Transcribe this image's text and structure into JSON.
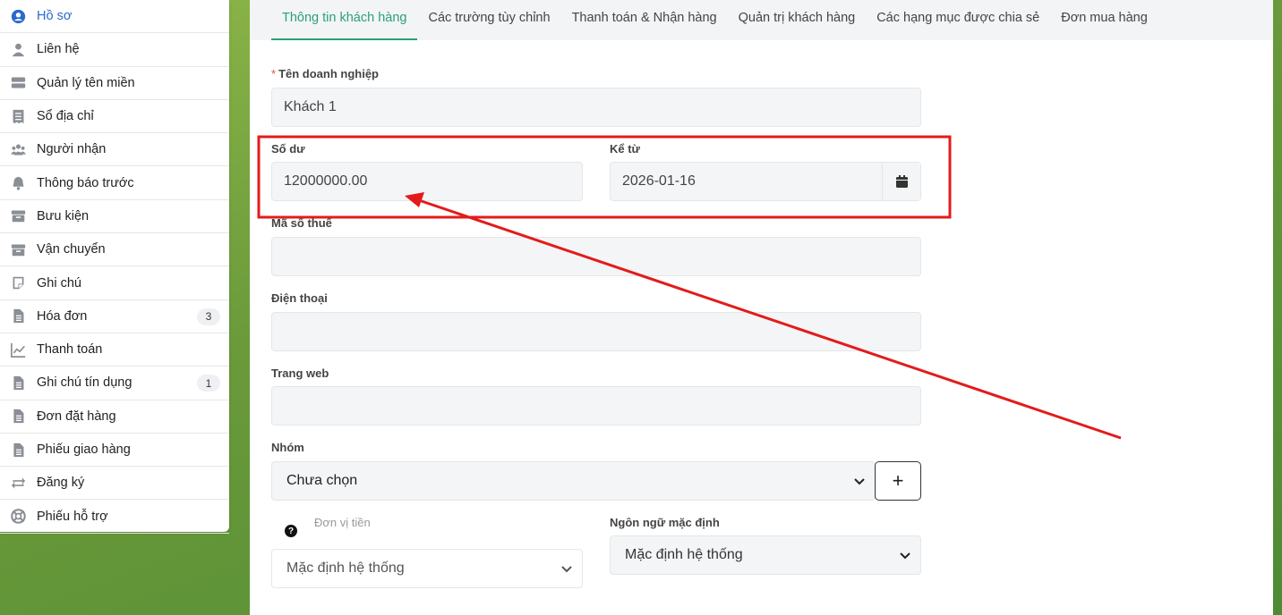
{
  "sidebar": {
    "items": [
      {
        "label": "Hồ sơ",
        "icon": "user-circle-icon"
      },
      {
        "label": "Liên hệ",
        "icon": "person-icon"
      },
      {
        "label": "Quản lý tên miền",
        "icon": "server-icon"
      },
      {
        "label": "Sổ địa chỉ",
        "icon": "receipt-icon"
      },
      {
        "label": "Người nhận",
        "icon": "users-icon"
      },
      {
        "label": "Thông báo trước",
        "icon": "bell-icon"
      },
      {
        "label": "Bưu kiện",
        "icon": "box-icon"
      },
      {
        "label": "Vận chuyển",
        "icon": "box-icon"
      },
      {
        "label": "Ghi chú",
        "icon": "note-icon"
      },
      {
        "label": "Hóa đơn",
        "icon": "document-icon",
        "badge": "3"
      },
      {
        "label": "Thanh toán",
        "icon": "chart-line-icon"
      },
      {
        "label": "Ghi chú tín dụng",
        "icon": "document-icon",
        "badge": "1"
      },
      {
        "label": "Đơn đặt hàng",
        "icon": "document-icon"
      },
      {
        "label": "Phiếu giao hàng",
        "icon": "document-icon"
      },
      {
        "label": "Đăng ký",
        "icon": "repeat-icon"
      },
      {
        "label": "Phiếu hỗ trợ",
        "icon": "lifebuoy-icon"
      }
    ]
  },
  "tabs": [
    "Thông tin khách hàng",
    "Các trường tùy chỉnh",
    "Thanh toán & Nhận hàng",
    "Quản trị khách hàng",
    "Các hạng mục được chia sẻ",
    "Đơn mua hàng"
  ],
  "form": {
    "company_label": "Tên doanh nghiệp",
    "company_required": "*",
    "company_value": "Khách 1",
    "balance_label": "Số dư",
    "balance_value": "12000000.00",
    "since_label": "Kể từ",
    "since_value": "2026-01-16",
    "tax_label": "Mã số thuế",
    "phone_label": "Điện thoại",
    "website_label": "Trang web",
    "group_label": "Nhóm",
    "group_value": "Chưa chọn",
    "add_symbol": "+",
    "currency_label": "Đơn vị tiền",
    "currency_help": "?",
    "currency_value": "Mặc định hệ thống",
    "language_label": "Ngôn ngữ mặc định",
    "language_value": "Mặc định hệ thống"
  },
  "colors": {
    "accent": "#2aa079",
    "active_link": "#2a6acb",
    "annotation": "#e31b1b"
  }
}
